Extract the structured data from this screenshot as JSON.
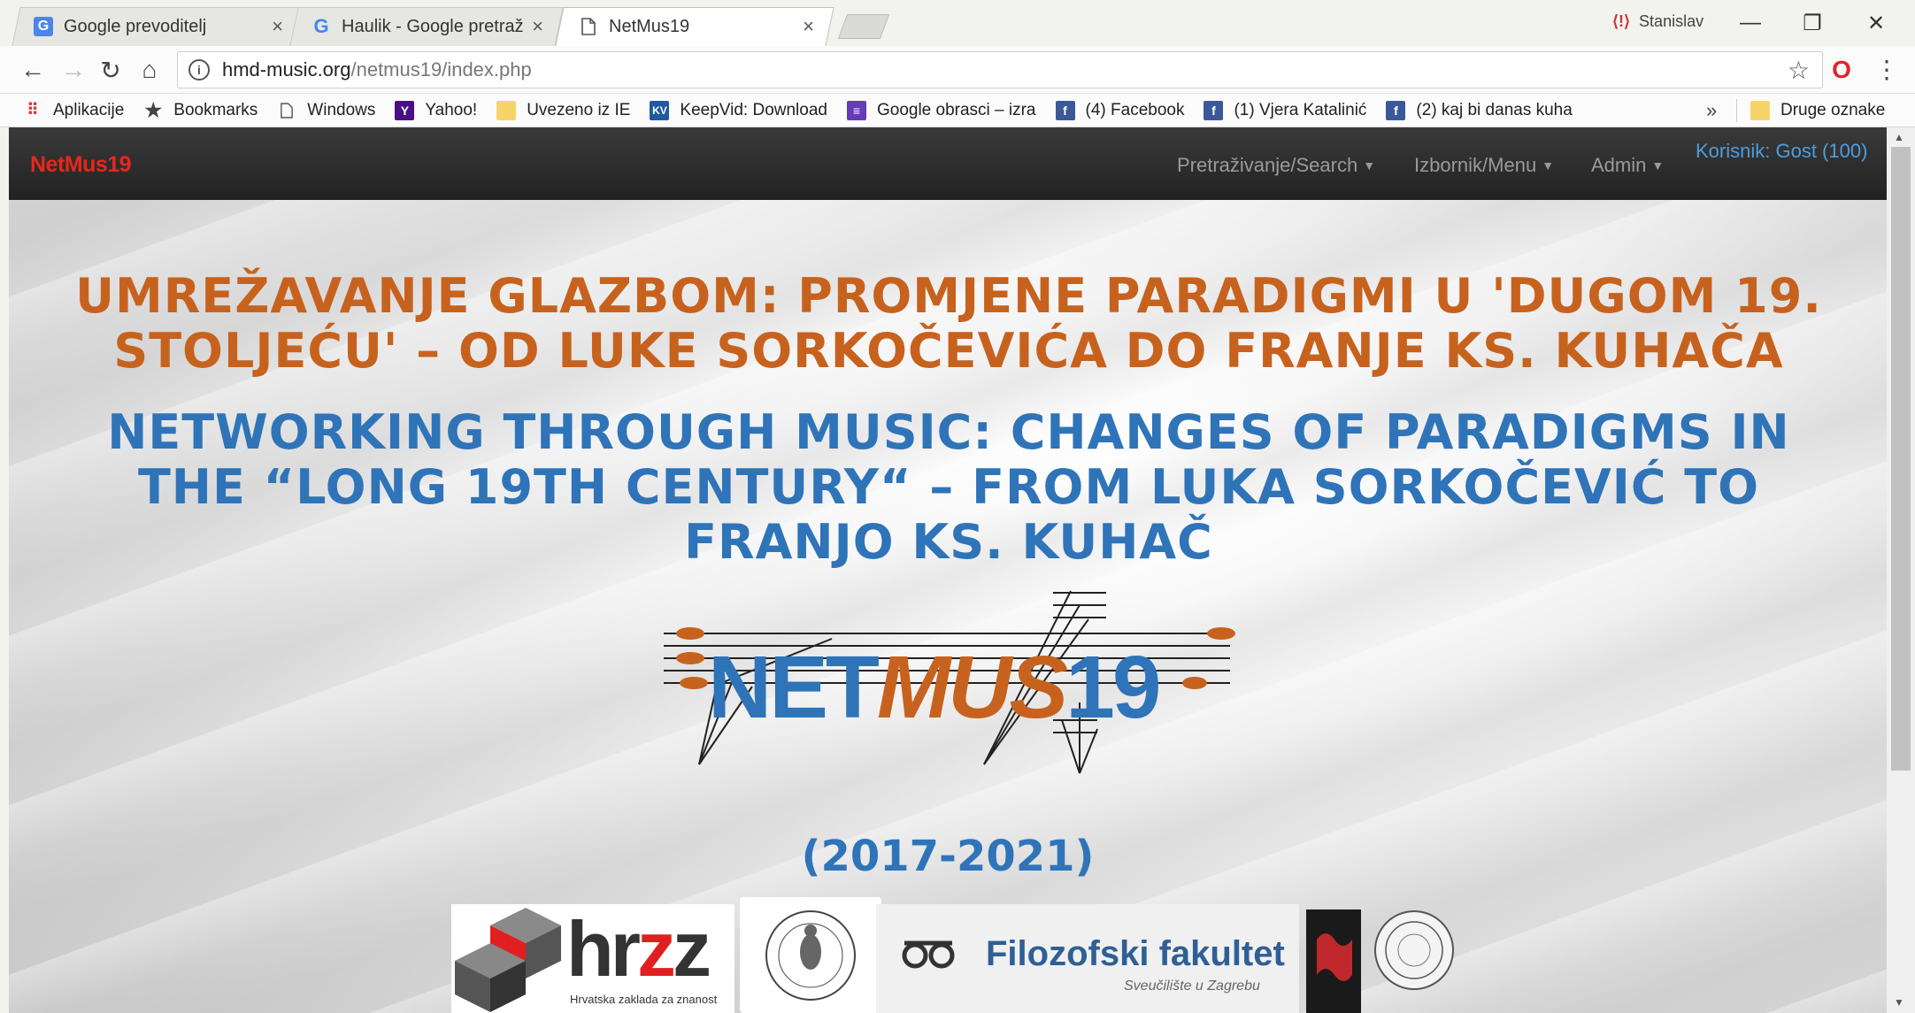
{
  "browser": {
    "tabs": [
      {
        "label": "Google prevoditelj",
        "icon": "google-translate-icon",
        "close": "×"
      },
      {
        "label": "Haulik - Google pretraživ",
        "icon": "google-g-icon",
        "close": "×"
      },
      {
        "label": "NetMus19",
        "icon": "page-icon",
        "close": "×"
      }
    ],
    "profile_name": "Stanislav",
    "window_controls": {
      "minimize": "—",
      "restore": "❐",
      "close": "✕"
    },
    "address": {
      "host": "hmd-music.org",
      "path": "/netmus19/index.php"
    },
    "bookmarks": [
      {
        "label": "Aplikacije",
        "icon": "apps-grid-icon"
      },
      {
        "label": "Bookmarks",
        "icon": "star-icon"
      },
      {
        "label": "Windows",
        "icon": "page-icon"
      },
      {
        "label": "Yahoo!",
        "icon": "yahoo-icon"
      },
      {
        "label": "Uvezeno iz IE",
        "icon": "folder-icon"
      },
      {
        "label": "KeepVid: Download",
        "icon": "keepvid-icon"
      },
      {
        "label": "Google obrasci – izra",
        "icon": "google-forms-icon"
      },
      {
        "label": "(4) Facebook",
        "icon": "facebook-icon"
      },
      {
        "label": "(1) Vjera Katalinić",
        "icon": "facebook-icon"
      },
      {
        "label": "(2) kaj bi danas kuha",
        "icon": "facebook-icon"
      }
    ],
    "bookmarks_more": "»",
    "other_bookmarks": "Druge oznake"
  },
  "site": {
    "brand": "NetMus19",
    "nav": [
      {
        "label": "Pretraživanje/Search"
      },
      {
        "label": "Izbornik/Menu"
      },
      {
        "label": "Admin"
      }
    ],
    "user": "Korisnik: Gost (100)",
    "heading_hr": [
      "UMREŽAVANJE GLAZBOM: PROMJENE PARADIGMI U 'DUGOM 19.",
      "STOLJEĆU' – OD LUKE SORKOČEVIĆA DO FRANJE KS. KUHAČA"
    ],
    "heading_en": [
      "NETWORKING THROUGH MUSIC: CHANGES OF PARADIGMS IN",
      "THE “LONG 19TH CENTURY“ – FROM LUKA SORKOČEVIĆ TO",
      "FRANJO KS. KUHAČ"
    ],
    "logo": {
      "part1": "NET",
      "part2": "MUS",
      "part3": "19"
    },
    "years": "(2017-2021)",
    "partners": {
      "hrzz": {
        "name": "hrzz",
        "caption": "Hrvatska zaklada za znanost"
      },
      "ffzg": {
        "name": "Filozofski fakultet",
        "caption": "Sveučilište u Zagrebu"
      }
    },
    "colors": {
      "orange": "#c7621e",
      "blue": "#2f74b8",
      "brand_red": "#e8261c",
      "link": "#4a9ee0"
    }
  }
}
